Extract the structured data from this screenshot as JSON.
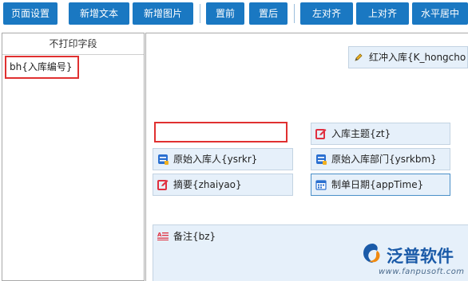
{
  "toolbar": {
    "buttons": [
      {
        "label": "页面设置"
      },
      {
        "label": "新增文本"
      },
      {
        "label": "新增图片"
      },
      {
        "label": "置前"
      },
      {
        "label": "置后"
      },
      {
        "label": "左对齐"
      },
      {
        "label": "上对齐"
      },
      {
        "label": "水平居中"
      }
    ],
    "accent": "#1a78c2"
  },
  "left_panel": {
    "header": "不打印字段",
    "items": [
      {
        "label": "bh{入库编号}"
      }
    ]
  },
  "canvas": {
    "fields": [
      {
        "label": "红冲入库{K_hongcho",
        "icon": "pencil-icon"
      },
      {
        "label": "入库主题{zt}",
        "icon": "edit-icon"
      },
      {
        "label": "原始入库人{ysrkr}",
        "icon": "list-icon"
      },
      {
        "label": "原始入库部门{ysrkbm}",
        "icon": "list-icon"
      },
      {
        "label": "摘要{zhaiyao}",
        "icon": "edit-icon"
      },
      {
        "label": "制单日期{appTime}",
        "icon": "calendar-icon"
      }
    ],
    "memo": {
      "label": "备注{bz}",
      "icon": "textarea-icon"
    }
  },
  "watermark": {
    "name": "泛普软件",
    "url": "www.fanpusoft.com"
  },
  "colors": {
    "highlight": "#e03030",
    "field_bg": "#e6f0fa"
  }
}
